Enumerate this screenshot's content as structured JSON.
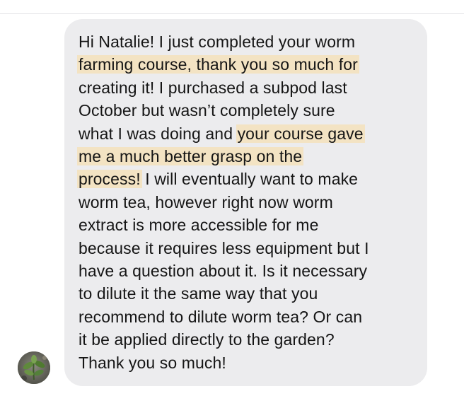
{
  "message": {
    "lines": [
      [
        {
          "text": "Hi Natalie! I just completed your worm",
          "hl": false
        }
      ],
      [
        {
          "text": "farming course, thank you so much for",
          "hl": true
        }
      ],
      [
        {
          "text": "creating it! I purchased a subpod last",
          "hl": false
        }
      ],
      [
        {
          "text": "October but wasn’t completely sure",
          "hl": false
        }
      ],
      [
        {
          "text": "what I was doing and ",
          "hl": false
        },
        {
          "text": "your course gave",
          "hl": true
        }
      ],
      [
        {
          "text": "me a much better grasp on the",
          "hl": true
        }
      ],
      [
        {
          "text": "process!",
          "hl": true
        },
        {
          "text": " I will eventually want to make",
          "hl": false
        }
      ],
      [
        {
          "text": "worm tea, however right now worm",
          "hl": false
        }
      ],
      [
        {
          "text": "extract is more accessible for me",
          "hl": false
        }
      ],
      [
        {
          "text": "because it requires less equipment but I",
          "hl": false
        }
      ],
      [
        {
          "text": "have a question about it. Is it necessary",
          "hl": false
        }
      ],
      [
        {
          "text": "to dilute it the same way that you",
          "hl": false
        }
      ],
      [
        {
          "text": "recommend to dilute worm tea? Or can",
          "hl": false
        }
      ],
      [
        {
          "text": "it be applied directly to the garden?",
          "hl": false
        }
      ],
      [
        {
          "text": "Thank you so much!",
          "hl": false
        }
      ]
    ],
    "colors": {
      "bubble": "#ececee",
      "highlight": "#f3e3c3",
      "text": "#151515"
    }
  },
  "avatar": {
    "icon": "plant-avatar-icon"
  }
}
